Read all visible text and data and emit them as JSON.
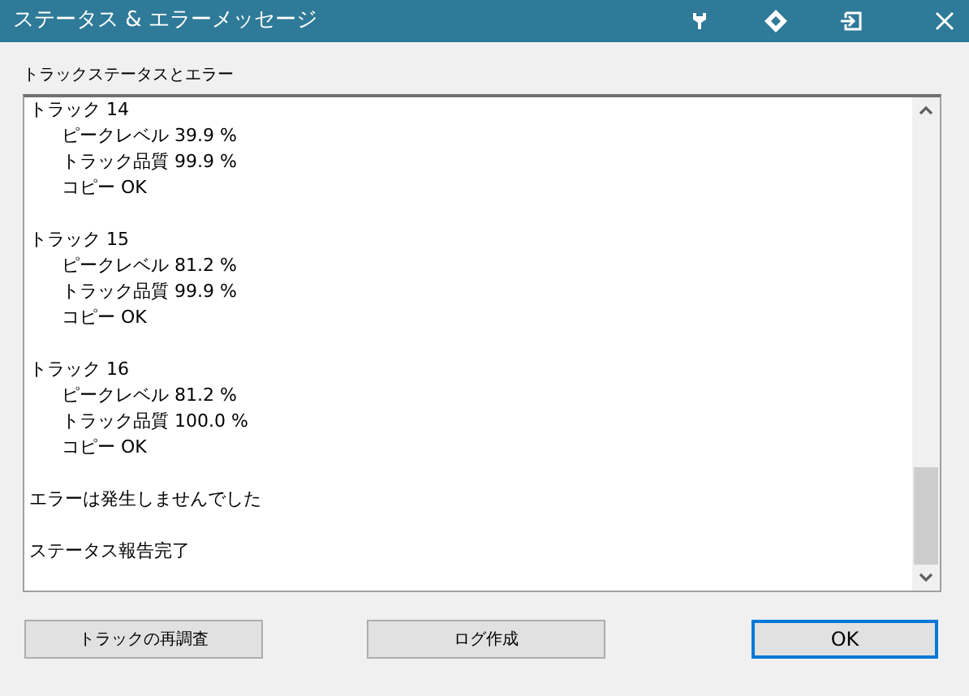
{
  "window": {
    "title": "ステータス & エラーメッセージ"
  },
  "group_label": "トラックステータスとエラー",
  "log": [
    {
      "text": "トラック 14",
      "children": [
        {
          "text": "ピークレベル 39.9 %"
        },
        {
          "text": "トラック品質 99.9 %"
        },
        {
          "text": "コピー OK"
        }
      ]
    },
    {
      "text": "トラック 15",
      "children": [
        {
          "text": "ピークレベル 81.2 %"
        },
        {
          "text": "トラック品質 99.9 %"
        },
        {
          "text": "コピー OK"
        }
      ]
    },
    {
      "text": "トラック 16",
      "children": [
        {
          "text": "ピークレベル 81.2 %"
        },
        {
          "text": "トラック品質 100.0 %"
        },
        {
          "text": "コピー OK"
        }
      ]
    },
    {
      "text": "エラーは発生しませんでした"
    },
    {
      "text": "ステータス報告完了"
    }
  ],
  "buttons": [
    {
      "label": "トラックの再調査",
      "selected": false
    },
    {
      "label": "ログ作成",
      "selected": false
    },
    {
      "label": "OK",
      "selected": true
    }
  ]
}
